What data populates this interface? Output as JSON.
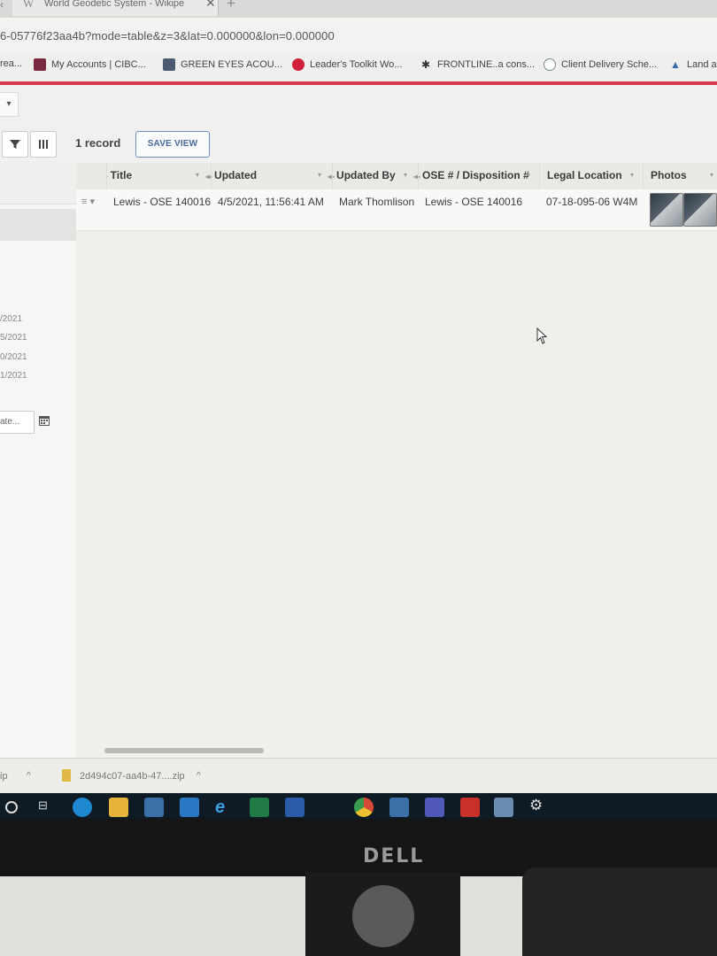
{
  "browser": {
    "tab_title": "World Geodetic System - Wikipe",
    "tab_logo": "W",
    "tab_close": "✕",
    "tab_left_glyph": "‹",
    "new_tab": "+",
    "url": "6-05776f23aa4b?mode=table&z=3&lat=0.000000&lon=0.000000"
  },
  "bookmarks": [
    {
      "label": "rea...",
      "icon": "none"
    },
    {
      "label": "My Accounts | CIBC...",
      "icon": "cibc-icon",
      "color": "#7a2a40"
    },
    {
      "label": "GREEN EYES ACOU...",
      "icon": "site-icon",
      "color": "#4a5a70"
    },
    {
      "label": "Leader's Toolkit Wo...",
      "icon": "red-drop-icon",
      "color": "#d0203a"
    },
    {
      "label": "FRONTLINE..a cons...",
      "icon": "leaf-icon",
      "color": "#333333"
    },
    {
      "label": "Client Delivery Sche...",
      "icon": "globe-icon",
      "color": "#7a8a90"
    },
    {
      "label": "Land a",
      "icon": "drive-icon",
      "color": "#3a6ab0"
    }
  ],
  "toolbar": {
    "record_count": "1 record",
    "save_view": "SAVE VIEW",
    "filter_icon": "filter-icon",
    "columns_icon": "columns-icon"
  },
  "left_panel": {
    "dates": [
      "/2021",
      "5/2021",
      "0/2021",
      "1/2021"
    ],
    "date_input": "ate..."
  },
  "grid": {
    "columns": [
      "Title",
      "Updated",
      "Updated By",
      "OSE # / Disposition #",
      "Legal Location",
      "Photos"
    ],
    "rows": [
      {
        "title": "Lewis - OSE 140016",
        "updated": "4/5/2021, 11:56:41 AM",
        "updated_by": "Mark Thomlison",
        "ose": "Lewis - OSE 140016",
        "legal_location": "07-18-095-06 W4M",
        "photo_count": 2
      }
    ]
  },
  "downloads": [
    {
      "label": "ip"
    },
    {
      "label": "2d494c07-aa4b-47....zip"
    }
  ],
  "monitor": {
    "brand": "DELL"
  },
  "colors": {
    "accent_line": "#d83b4b",
    "save_button": "#4a6aa3"
  }
}
